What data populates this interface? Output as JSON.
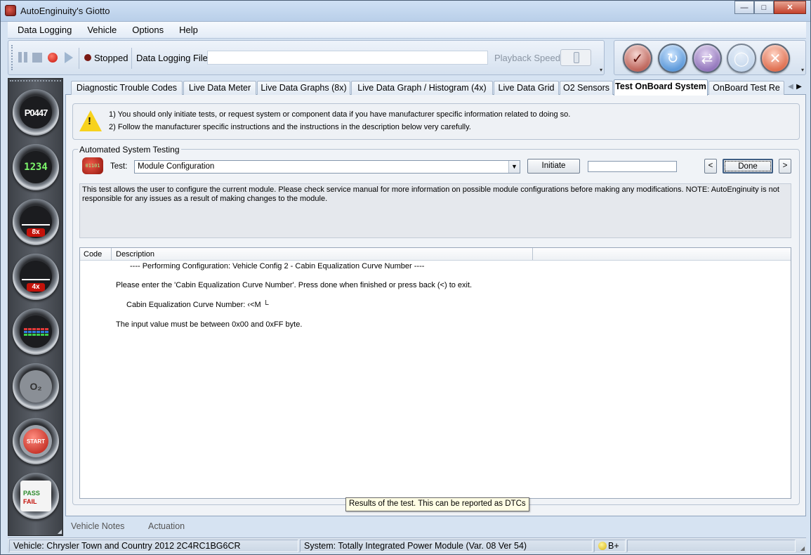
{
  "window": {
    "title": "AutoEnginuity's Giotto",
    "controls": {
      "minimize": "—",
      "maximize": "□",
      "close": "✕"
    }
  },
  "menu": [
    "Data Logging",
    "Vehicle",
    "Options",
    "Help"
  ],
  "toolbar": {
    "status_label": "Stopped",
    "data_logging_file_label": "Data Logging File",
    "data_logging_file_value": "",
    "playback_speed_label": "Playback Speed",
    "overflow": "▾"
  },
  "toolbar_right_icons": [
    "clipboard-check-icon",
    "refresh-icon",
    "vehicle-sync-icon",
    "disabled-plugin-icon",
    "close-connection-icon"
  ],
  "rail": {
    "icons": [
      "dtc-icon",
      "data-meter-icon",
      "graphs-8x-icon",
      "graph-4x-icon",
      "data-grid-icon",
      "o2-sensor-icon",
      "start-test-icon",
      "pass-fail-icon"
    ],
    "dtc_text": "P0447",
    "meter_text": "1234",
    "graph8_badge": "8x",
    "graph4_badge": "4x",
    "start_text": "START",
    "pass_text": "PASS",
    "fail_text": "FAIL"
  },
  "tabs": [
    "Diagnostic Trouble Codes",
    "Live Data Meter",
    "Live Data Graphs (8x)",
    "Live Data Graph / Histogram (4x)",
    "Live Data Grid",
    "O2 Sensors",
    "Test OnBoard System",
    "OnBoard Test Re"
  ],
  "active_tab": "Test OnBoard System",
  "warning": {
    "line1": "1) You should only initiate tests, or request system or component data if you have manufacturer specific information related to doing so.",
    "line2": "2) Follow the manufacturer specific instructions and the instructions in the description below very carefully."
  },
  "automated": {
    "legend": "Automated System Testing",
    "test_icon_text": "01101",
    "test_label": "Test:",
    "test_value": "Module Configuration",
    "initiate_label": "Initiate",
    "value_input": "",
    "back_label": "<",
    "done_label": "Done",
    "next_label": ">",
    "description": "This test allows the user to configure the current module. Please check service manual for more information on possible module configurations before making any modifications. NOTE: AutoEnginuity is not responsible for any issues as a result of making changes to the module."
  },
  "results": {
    "columns": [
      "Code",
      "Description"
    ],
    "lines": [
      "---- Performing Configuration: Vehicle Config 2 - Cabin Equalization Curve Number ----",
      "Please enter the 'Cabin Equalization Curve Number'. Press done when finished or press back (<) to exit.",
      "Cabin Equalization Curve Number: ‹<M └",
      "The input value must be between 0x00 and 0xFF byte."
    ]
  },
  "tooltip": "Results of the test. This can be reported as DTCs",
  "bottom_tabs": [
    "Vehicle Notes",
    "Actuation"
  ],
  "status": {
    "vehicle": "Vehicle: Chrysler  Town and Country  2012  2C4RC1BG6CR",
    "system": "System: Totally Integrated Power Module (Var. 08 Ver 54)",
    "battery": "B+"
  }
}
